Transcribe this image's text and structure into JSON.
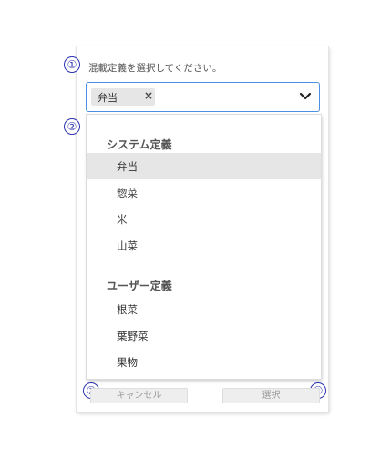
{
  "annotations": [
    "①",
    "②",
    "③",
    "④"
  ],
  "prompt": "混載定義を選択してください。",
  "select": {
    "chips": [
      {
        "label": "弁当",
        "remove_symbol": "×"
      }
    ],
    "toggle_icon": "chevron-down-icon"
  },
  "dropdown": {
    "groups": [
      {
        "label": "システム定義",
        "options": [
          "弁当",
          "惣菜",
          "米",
          "山菜"
        ]
      },
      {
        "label": "ユーザー定義",
        "options": [
          "根菜",
          "葉野菜",
          "果物"
        ]
      }
    ],
    "selected_option": "弁当"
  },
  "buttons": {
    "cancel": "キャンセル",
    "select": "選択"
  },
  "colors": {
    "focus_border": "#4a90e2",
    "annotation": "#2a32b0",
    "selected_bg": "#e6e6e6"
  }
}
